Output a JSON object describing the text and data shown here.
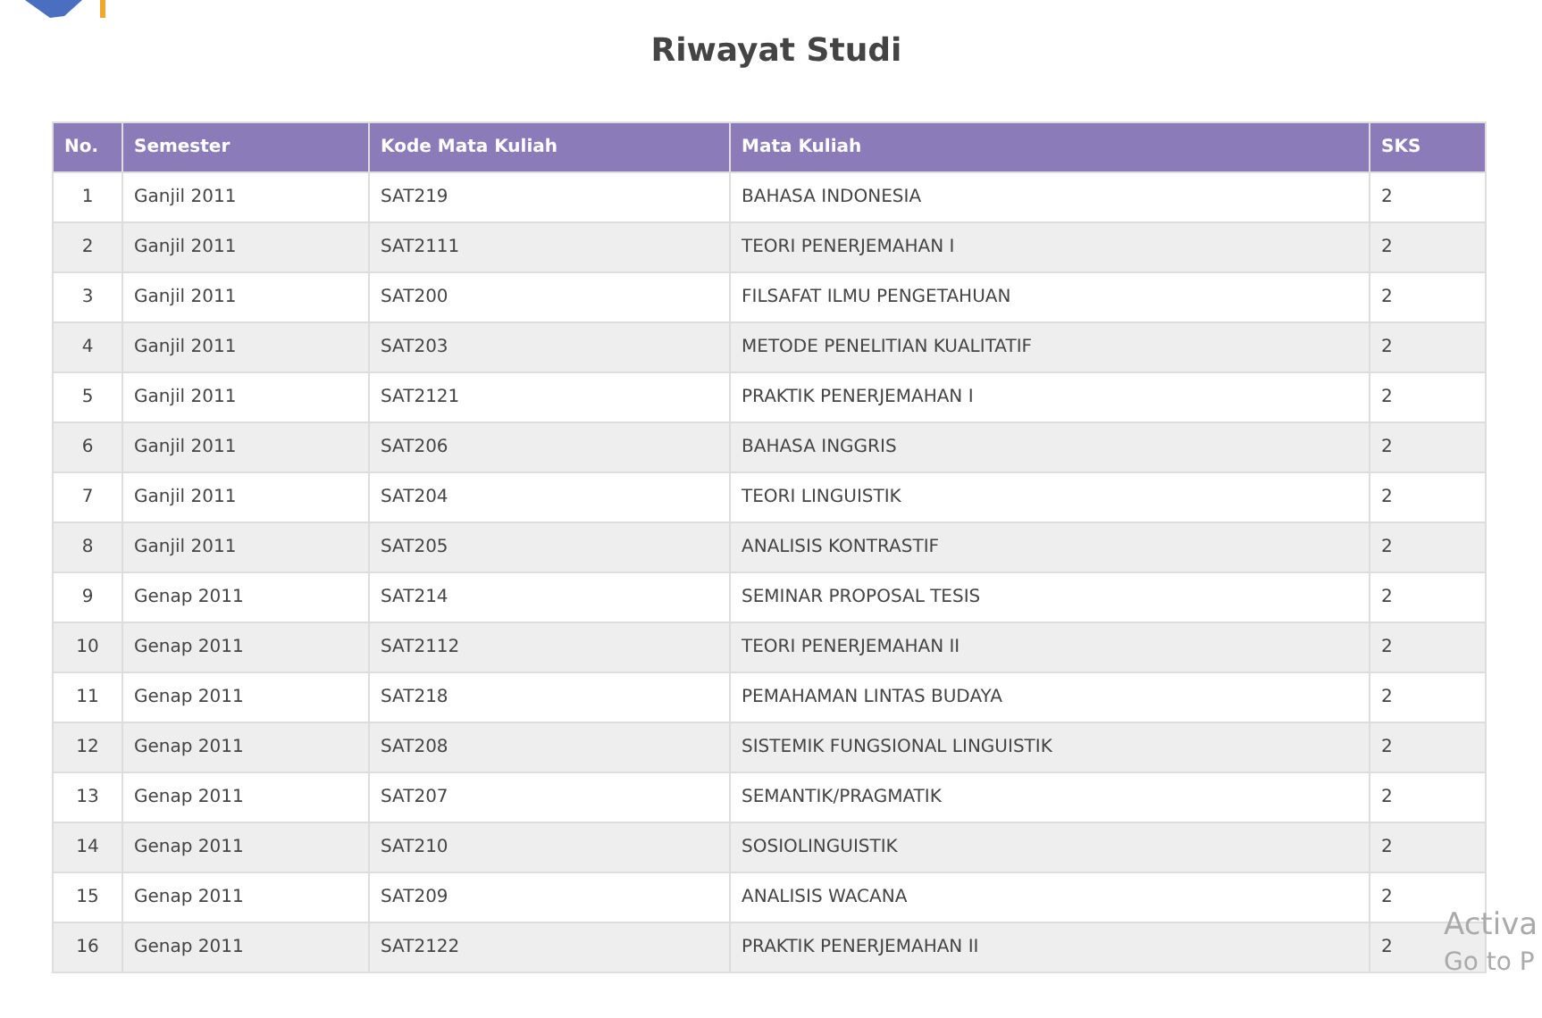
{
  "title": "Riwayat Studi",
  "table": {
    "columns": [
      "No.",
      "Semester",
      "Kode Mata Kuliah",
      "Mata Kuliah",
      "SKS"
    ],
    "rows": [
      [
        "1",
        "Ganjil 2011",
        "SAT219",
        "BAHASA INDONESIA",
        "2"
      ],
      [
        "2",
        "Ganjil 2011",
        "SAT2111",
        "TEORI PENERJEMAHAN I",
        "2"
      ],
      [
        "3",
        "Ganjil 2011",
        "SAT200",
        "FILSAFAT ILMU PENGETAHUAN",
        "2"
      ],
      [
        "4",
        "Ganjil 2011",
        "SAT203",
        "METODE PENELITIAN KUALITATIF",
        "2"
      ],
      [
        "5",
        "Ganjil 2011",
        "SAT2121",
        "PRAKTIK PENERJEMAHAN I",
        "2"
      ],
      [
        "6",
        "Ganjil 2011",
        "SAT206",
        "BAHASA INGGRIS",
        "2"
      ],
      [
        "7",
        "Ganjil 2011",
        "SAT204",
        "TEORI LINGUISTIK",
        "2"
      ],
      [
        "8",
        "Ganjil 2011",
        "SAT205",
        "ANALISIS KONTRASTIF",
        "2"
      ],
      [
        "9",
        "Genap 2011",
        "SAT214",
        "SEMINAR PROPOSAL TESIS",
        "2"
      ],
      [
        "10",
        "Genap 2011",
        "SAT2112",
        "TEORI PENERJEMAHAN II",
        "2"
      ],
      [
        "11",
        "Genap 2011",
        "SAT218",
        "PEMAHAMAN LINTAS BUDAYA",
        "2"
      ],
      [
        "12",
        "Genap 2011",
        "SAT208",
        "SISTEMIK FUNGSIONAL LINGUISTIK",
        "2"
      ],
      [
        "13",
        "Genap 2011",
        "SAT207",
        "SEMANTIK/PRAGMATIK",
        "2"
      ],
      [
        "14",
        "Genap 2011",
        "SAT210",
        "SOSIOLINGUISTIK",
        "2"
      ],
      [
        "15",
        "Genap 2011",
        "SAT209",
        "ANALISIS WACANA",
        "2"
      ],
      [
        "16",
        "Genap 2011",
        "SAT2122",
        "PRAKTIK PENERJEMAHAN II",
        "2"
      ]
    ]
  },
  "os_notice": {
    "line_1": "Activa",
    "line_2": "Go to P"
  }
}
